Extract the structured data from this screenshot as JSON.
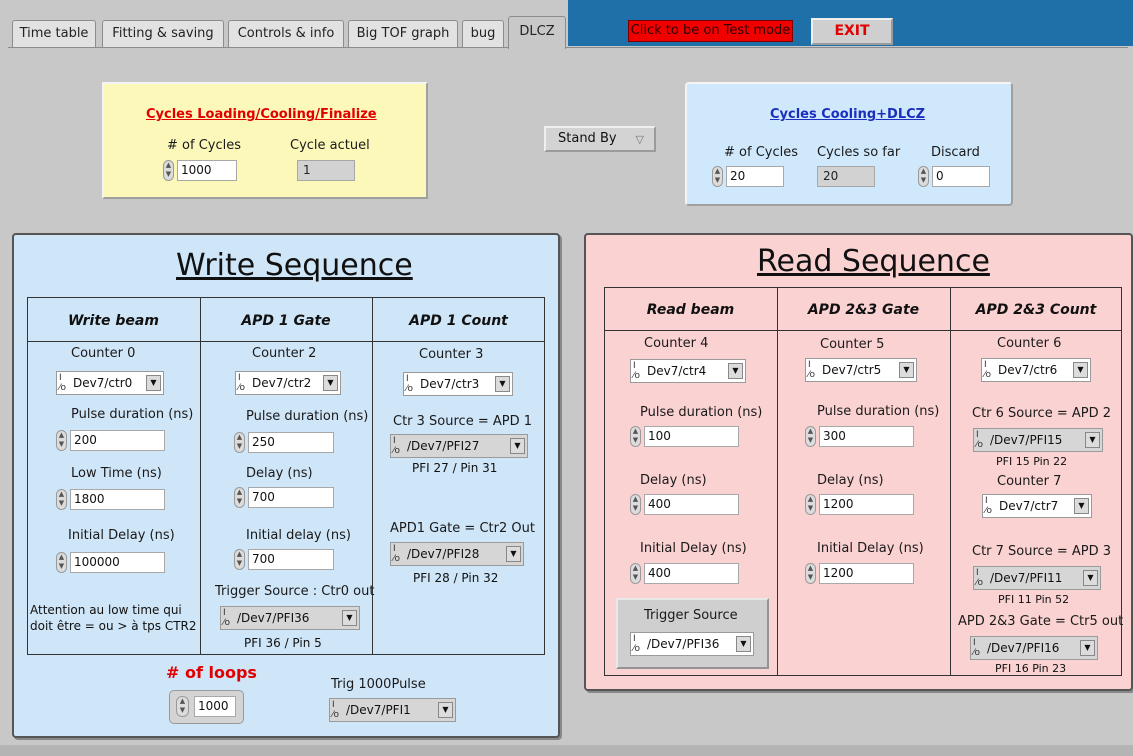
{
  "tabs": [
    {
      "label": "Time table"
    },
    {
      "label": "Fitting & saving"
    },
    {
      "label": "Controls & info"
    },
    {
      "label": "Big TOF graph"
    },
    {
      "label": "bug"
    },
    {
      "label": "DLCZ"
    }
  ],
  "active_tab": "DLCZ",
  "header": {
    "test_mode_label": "Click to be on Test mode",
    "exit_label": "EXIT"
  },
  "colors": {
    "test_mode_bg": "#f20000",
    "exit_text": "#e10000",
    "blue_header": "#1f6fa8",
    "yellow_box": "#fcf8b9",
    "blue_box": "#cfe8fb",
    "write_panel": "#cfe5f8",
    "read_panel": "#fbd2d2",
    "loops_title": "#e00000"
  },
  "cycles_loading": {
    "title": "Cycles Loading/Cooling/Finalize",
    "num_cycles_label": "# of Cycles",
    "num_cycles_value": "1000",
    "current_label": "Cycle actuel",
    "current_value": "1"
  },
  "standby": {
    "label": "Stand By"
  },
  "cycles_dlcz": {
    "title": "Cycles Cooling+DLCZ",
    "num_cycles_label": "# of Cycles",
    "num_cycles_value": "20",
    "so_far_label": "Cycles so far",
    "so_far_value": "20",
    "discard_label": "Discard",
    "discard_value": "0"
  },
  "write": {
    "title": "Write Sequence",
    "col1": {
      "header": "Write beam",
      "counter_label": "Counter 0",
      "counter_value": "Dev7/ctr0",
      "pulse_label": "Pulse duration (ns)",
      "pulse_value": "200",
      "low_label": "Low Time (ns)",
      "low_value": "1800",
      "init_label": "Initial Delay (ns)",
      "init_value": "100000",
      "note_line1": "Attention au low time qui",
      "note_line2": "doit être = ou > à tps CTR2"
    },
    "col2": {
      "header": "APD 1 Gate",
      "counter_label": "Counter 2",
      "counter_value": "Dev7/ctr2",
      "pulse_label": "Pulse duration (ns)",
      "pulse_value": "250",
      "delay_label": "Delay (ns)",
      "delay_value": "700",
      "init_label": "Initial delay (ns)",
      "init_value": "700",
      "trig_label": "Trigger Source : Ctr0 out",
      "trig_value": "/Dev7/PFI36",
      "trig_pin": "PFI 36 / Pin 5"
    },
    "col3": {
      "header": "APD 1 Count",
      "counter_label": "Counter 3",
      "counter_value": "Dev7/ctr3",
      "source_label": "Ctr 3 Source = APD 1",
      "source_value": "/Dev7/PFI27",
      "source_pin": "PFI 27 / Pin 31",
      "gate_label": "APD1 Gate = Ctr2 Out",
      "gate_value": "/Dev7/PFI28",
      "gate_pin": "PFI 28 / Pin 32"
    },
    "loops_label": "# of loops",
    "loops_value": "1000",
    "trig1000_label": "Trig 1000Pulse",
    "trig1000_value": "/Dev7/PFI1"
  },
  "read": {
    "title": "Read Sequence",
    "col1": {
      "header": "Read beam",
      "counter_label": "Counter 4",
      "counter_value": "Dev7/ctr4",
      "pulse_label": "Pulse duration (ns)",
      "pulse_value": "100",
      "delay_label": "Delay (ns)",
      "delay_value": "400",
      "init_label": "Initial Delay (ns)",
      "init_value": "400",
      "trig_label": "Trigger Source",
      "trig_value": "/Dev7/PFI36"
    },
    "col2": {
      "header": "APD 2&3 Gate",
      "counter_label": "Counter 5",
      "counter_value": "Dev7/ctr5",
      "pulse_label": "Pulse duration (ns)",
      "pulse_value": "300",
      "delay_label": "Delay (ns)",
      "delay_value": "1200",
      "init_label": "Initial Delay (ns)",
      "init_value": "1200"
    },
    "col3": {
      "header": "APD 2&3 Count",
      "counter6_label": "Counter 6",
      "counter6_value": "Dev7/ctr6",
      "src6_label": "Ctr 6 Source = APD 2",
      "src6_value": "/Dev7/PFI15",
      "src6_pin": "PFI 15 Pin 22",
      "counter7_label": "Counter 7",
      "counter7_value": "Dev7/ctr7",
      "src7_label": "Ctr 7 Source = APD 3",
      "src7_value": "/Dev7/PFI11",
      "src7_pin": "PFI 11 Pin 52",
      "gate_label": "APD 2&3 Gate = Ctr5 out",
      "gate_value": "/Dev7/PFI16",
      "gate_pin": "PFI 16 Pin 23"
    }
  },
  "icons": {
    "io": "I/O",
    "dropdown_arrow": "▼",
    "spin_up": "▲",
    "spin_down": "▼",
    "standby_arrow": "▽"
  }
}
